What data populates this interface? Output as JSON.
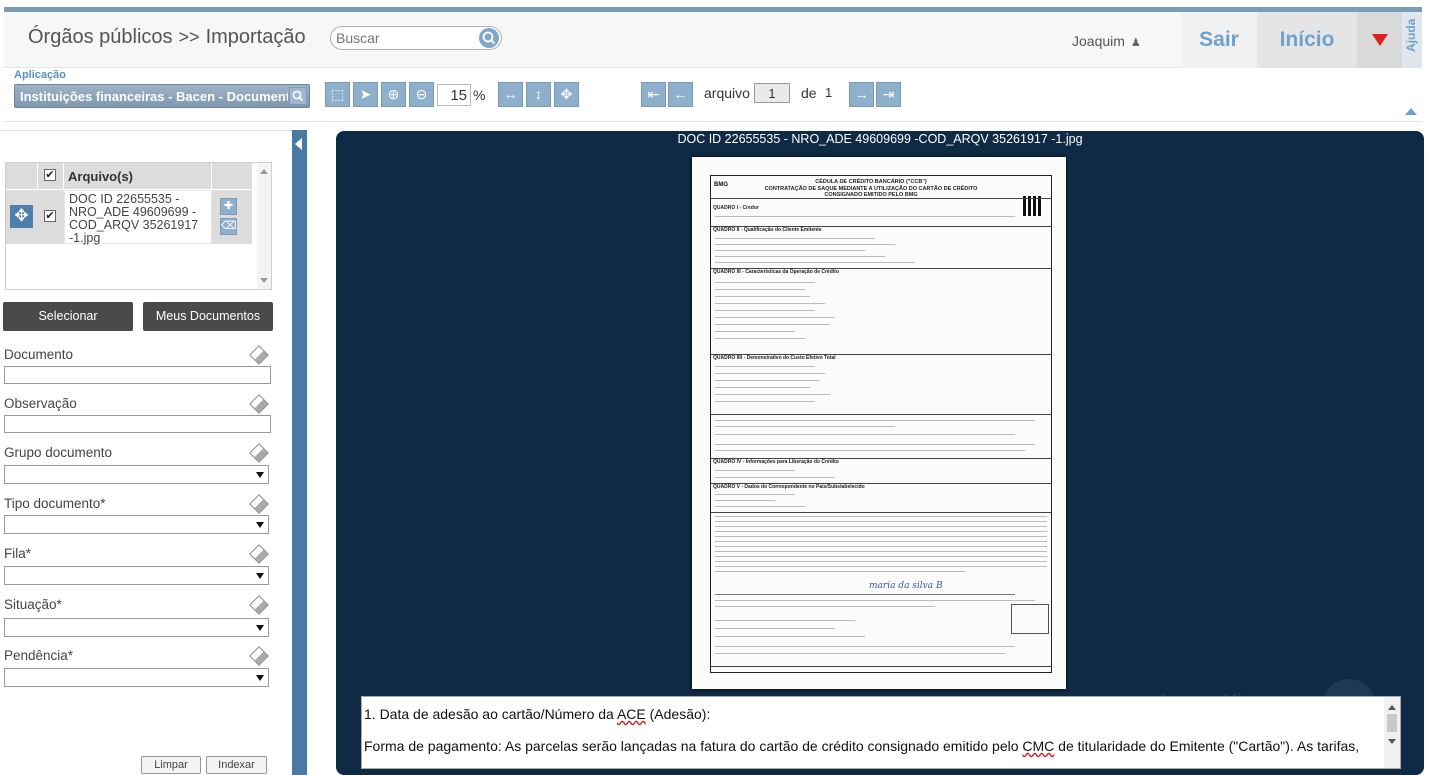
{
  "header": {
    "breadcrumb_part1": "Órgãos públicos",
    "breadcrumb_sep": ">>",
    "breadcrumb_part2": "Importação",
    "search_placeholder": "Buscar",
    "user_name": "Joaquim",
    "sair_label": "Sair",
    "inicio_label": "Início",
    "ajuda_label": "Ajuda"
  },
  "toolbar": {
    "aplicacao_label": "Aplicação",
    "aplicacao_value": "Instituições financeiras - Bacen - Documentos",
    "zoom_value": "15",
    "zoom_unit": "%",
    "arquivo_label": "arquivo",
    "arquivo_value": "1",
    "de_label": "de",
    "total": "1"
  },
  "file_list": {
    "header": "Arquivo(s)",
    "items": [
      {
        "name": "DOC ID 22655535 - NRO_ADE 49609699 - COD_ARQV 35261917 -1.jpg",
        "checked": true
      }
    ]
  },
  "buttons": {
    "selecionar": "Selecionar",
    "meus_documentos": "Meus Documentos",
    "limpar": "Limpar",
    "indexar": "Indexar"
  },
  "form": {
    "documento": "Documento",
    "observacao": "Observação",
    "grupo_documento": "Grupo documento",
    "tipo_documento": "Tipo documento*",
    "fila": "Fila*",
    "situacao": "Situação*",
    "pendencia": "Pendência*"
  },
  "viewer": {
    "title": "DOC ID 22655535 - NRO_ADE 49609699 -COD_ARQV 35261917 -1.jpg",
    "watermark": "Image Viewer",
    "ocr_line1_a": "1. Data de adesão ao cartão/Número da ",
    "ocr_line1_u": "ACE",
    "ocr_line1_b": " (Adesão):",
    "ocr_line2_a": "Forma de pagamento: As parcelas serão lançadas na fatura do cartão de crédito consignado emitido pelo ",
    "ocr_line2_u": "CMC",
    "ocr_line2_b": " de titularidade do Emitente (\"Cartão\"). As tarifas,"
  },
  "document_page": {
    "logo": "BMG",
    "title_line1": "CÉDULA DE CRÉDITO BANCÁRIO (\"CCB\")",
    "title_line2": "CONTRATAÇÃO DE SAQUE MEDIANTE A UTILIZAÇÃO DO CARTÃO DE CRÉDITO CONSIGNADO EMITIDO PELO BMG",
    "q1": "QUADRO I - Credor",
    "q2": "QUADRO II - Qualificação do Cliente Emitente",
    "q3": "QUADRO III - Características da Operação de Crédito",
    "q4": "QUADRO IIII - Demonstrativo do Custo Efetivo Total",
    "q5": "QUADRO IV - Informações para Liberação do Crédito",
    "q6": "QUADRO V - Dados do Correspondente no País/Substabelecido",
    "signature": "maria da silva B"
  },
  "colors": {
    "accent": "#6ea1cc",
    "viewer_bg": "#0f2a45",
    "splitter": "#4a7aa4",
    "dark_button": "#4a4a4a",
    "menu_arrow": "#e02020"
  }
}
